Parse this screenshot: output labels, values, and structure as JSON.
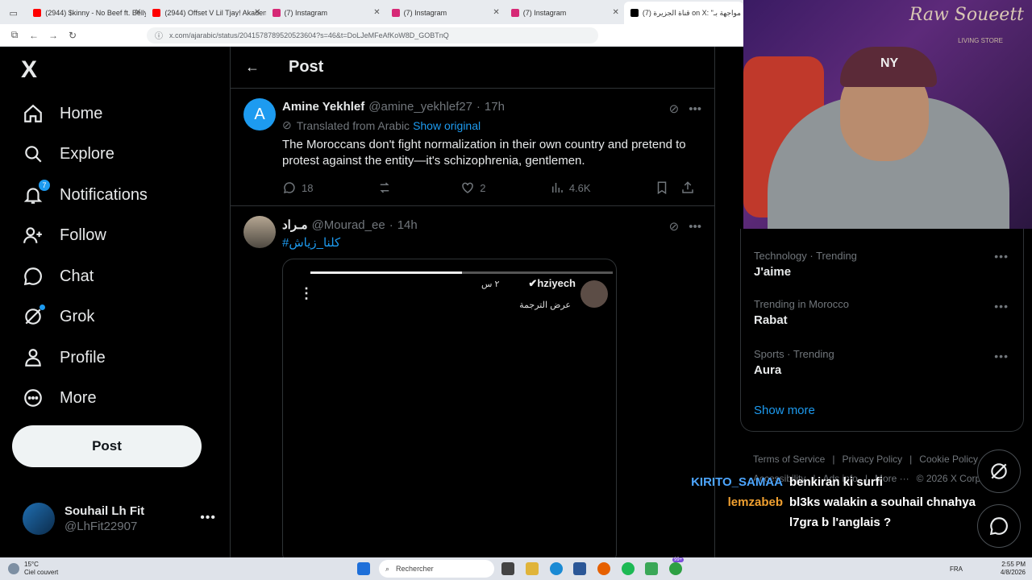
{
  "browser": {
    "tabs": [
      {
        "label": "(2944) $kinny - No Beef ft. Belly",
        "color": "#ff0000"
      },
      {
        "label": "(2944) Offset V Lil Tjay! Akaden",
        "color": "#ff0000"
      },
      {
        "label": "(7) Instagram",
        "color": "#d62976"
      },
      {
        "label": "(7) Instagram",
        "color": "#d62976"
      },
      {
        "label": "(7) Instagram",
        "color": "#d62976"
      },
      {
        "label": "(7) قناة الجزيرة on X: \"مواجهة بـ",
        "color": "#000000"
      }
    ],
    "url": "x.com/ajarabic/status/2041578789520523604?s=46&t=DoLJeMFeAfKoW8D_GOBTnQ"
  },
  "nav": {
    "logo": "X",
    "items": [
      {
        "label": "Home",
        "icon": "home-icon"
      },
      {
        "label": "Explore",
        "icon": "search-icon"
      },
      {
        "label": "Notifications",
        "icon": "bell-icon",
        "badge": "7"
      },
      {
        "label": "Follow",
        "icon": "follow-icon"
      },
      {
        "label": "Chat",
        "icon": "chat-icon"
      },
      {
        "label": "Grok",
        "icon": "grok-icon"
      },
      {
        "label": "Profile",
        "icon": "profile-icon"
      },
      {
        "label": "More",
        "icon": "more-icon"
      }
    ],
    "post_button": "Post",
    "account": {
      "name": "Souhail Lh Fit",
      "handle": "@LhFit22907"
    }
  },
  "main": {
    "title": "Post",
    "tweets": [
      {
        "avatar_letter": "A",
        "avatar_color": "#1d9bf0",
        "name": "Amine Yekhlef",
        "handle": "@amine_yekhlef27",
        "time": "17h",
        "translated_from": "Translated from Arabic",
        "show_original": "Show original",
        "text": "The Moroccans don't fight normalization in their own country and pretend to protest against the entity—it's schizophrenia, gentlemen.",
        "replies": "18",
        "likes": "2",
        "views": "4.6K"
      },
      {
        "name": "مـراد",
        "handle": "@Mourad_ee",
        "time": "14h",
        "hashtag": "#كلنا_زياش",
        "media": {
          "story_user": "hziyech",
          "story_time": "٢ س",
          "story_subtitle": "عرض الترجمة",
          "progress": 0.5
        }
      }
    ]
  },
  "trending": [
    {
      "category": "Technology · Trending",
      "title": "J'aime"
    },
    {
      "category": "Trending in Morocco",
      "title": "Rabat"
    },
    {
      "category": "Sports · Trending",
      "title": "Aura"
    }
  ],
  "show_more": "Show more",
  "footer": {
    "links": [
      "Terms of Service",
      "|",
      "Privacy Policy",
      "|",
      "Cookie Policy",
      "|",
      "Accessibility",
      "|",
      "Ads info",
      "|",
      "More ···",
      "© 2026 X Corp."
    ]
  },
  "webcam": {
    "brand": "Raw Soueett",
    "brand_sub": "LIVING STORE",
    "cap_logo": "NY"
  },
  "chat_overlay": [
    {
      "user": "KIRITO_SAMAA",
      "color": "#4da6ff",
      "message": "benkiran ki surfi"
    },
    {
      "user": "lemzabeb",
      "color": "#f0a030",
      "message": "bl3ks walakin a souhail chnahya l7gra b l'anglais ?"
    }
  ],
  "taskbar": {
    "weather_temp": "15°C",
    "weather_desc": "Ciel couvert",
    "search_placeholder": "Rechercher",
    "lang": "FRA",
    "time": "2:55 PM",
    "date": "4/8/2026",
    "tray_badge": "99+"
  }
}
